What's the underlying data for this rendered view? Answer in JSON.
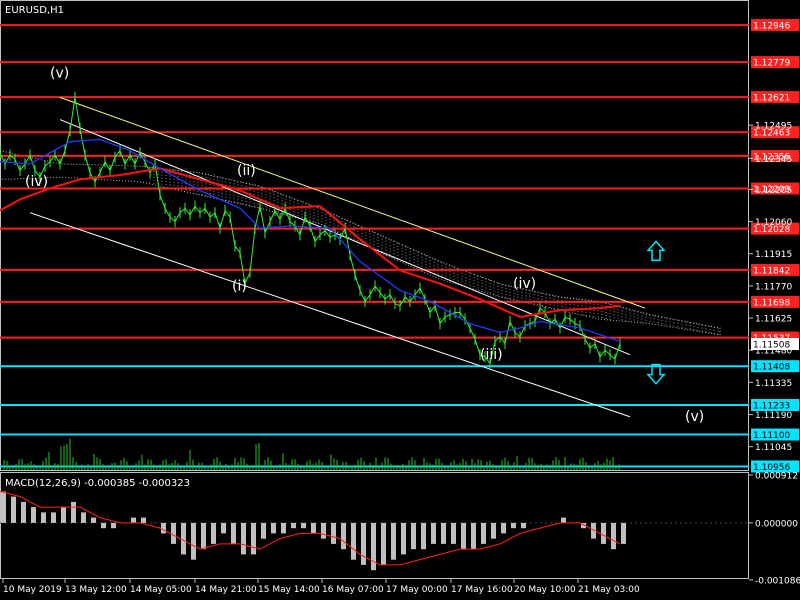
{
  "window": {
    "symbol_timeframe": "EURUSD,H1"
  },
  "chart_data": [
    {
      "type": "line",
      "title": "EURUSD,H1",
      "xlabel": "",
      "ylabel": "",
      "ylim": [
        1.1094,
        1.1305
      ],
      "grid": false,
      "x_ticks": [
        "10 May 2019",
        "13 May 12:00",
        "14 May 05:00",
        "14 May 21:00",
        "15 May 14:00",
        "16 May 07:00",
        "17 May 00:00",
        "17 May 16:00",
        "20 May 10:00",
        "21 May 03:00"
      ],
      "y_ticks": [
        1.12495,
        1.12345,
        1.12205,
        1.1206,
        1.11915,
        1.1177,
        1.11625,
        1.1148,
        1.11335,
        1.1119,
        1.11045
      ],
      "current_price": 1.11508,
      "level_lines": [
        {
          "price": 1.12946,
          "label": "1.12946",
          "color": "#ff2020"
        },
        {
          "price": 1.12779,
          "label": "1.12779",
          "color": "#ff2020"
        },
        {
          "price": 1.12621,
          "label": "1.12621",
          "color": "#ff2020"
        },
        {
          "price": 1.12463,
          "label": "1.12463",
          "color": "#ff2020"
        },
        {
          "price": 1.12356,
          "label": "1.12356",
          "color": "#ff2020"
        },
        {
          "price": 1.12209,
          "label": "1.12209",
          "color": "#ff2020"
        },
        {
          "price": 1.12028,
          "label": "1.12028",
          "color": "#ff2020"
        },
        {
          "price": 1.11842,
          "label": "1.11842",
          "color": "#ff2020"
        },
        {
          "price": 1.11698,
          "label": "1.11698",
          "color": "#ff2020"
        },
        {
          "price": 1.11537,
          "label": "1.11537",
          "color": "#ff2020"
        },
        {
          "price": 1.11408,
          "label": "1.11408",
          "color": "#00e5ff"
        },
        {
          "price": 1.11233,
          "label": "1.11233",
          "color": "#00e5ff"
        },
        {
          "price": 1.111,
          "label": "1.11100",
          "color": "#00e5ff"
        },
        {
          "price": 1.10956,
          "label": "1.10956",
          "color": "#00e5ff"
        }
      ],
      "series": [
        {
          "name": "",
          "color": "#33ee33",
          "x": [
            0,
            5,
            10,
            15,
            20,
            25,
            30,
            35,
            40,
            45,
            50,
            55,
            60,
            65,
            70,
            75,
            80,
            85,
            90,
            95,
            100,
            105,
            110,
            115,
            120,
            125,
            130,
            135,
            140,
            145,
            150,
            155,
            160,
            165,
            170,
            175,
            180,
            185,
            190,
            195,
            200,
            205,
            210,
            215,
            220,
            225,
            230,
            235,
            240,
            245,
            250,
            255,
            260,
            265,
            270,
            275,
            280,
            285,
            290,
            295,
            300,
            305,
            310,
            315,
            320,
            325,
            330,
            335,
            340,
            345,
            350,
            355,
            360,
            365,
            370,
            375,
            380,
            385,
            390,
            395,
            400,
            405,
            410,
            415,
            420,
            425,
            430,
            435,
            440,
            445,
            450,
            455,
            460,
            465,
            470,
            475,
            480,
            485,
            490,
            495,
            500,
            505,
            510,
            515,
            520,
            525,
            530,
            535,
            540,
            545,
            550,
            555,
            560,
            565,
            570,
            575,
            580,
            585,
            590,
            595,
            600,
            605,
            610,
            615,
            620
          ],
          "values": [
            1.1237,
            1.1232,
            1.1236,
            1.1234,
            1.1229,
            1.1232,
            1.1236,
            1.1229,
            1.1226,
            1.1231,
            1.1233,
            1.1236,
            1.1232,
            1.1238,
            1.1247,
            1.1262,
            1.1248,
            1.1236,
            1.1228,
            1.1224,
            1.1228,
            1.1233,
            1.1229,
            1.1235,
            1.1238,
            1.1232,
            1.1236,
            1.1232,
            1.1237,
            1.1233,
            1.1228,
            1.1232,
            1.1218,
            1.1212,
            1.1208,
            1.1206,
            1.121,
            1.1212,
            1.1209,
            1.1213,
            1.121,
            1.1212,
            1.1208,
            1.121,
            1.1203,
            1.1211,
            1.1208,
            1.1195,
            1.1192,
            1.1178,
            1.1183,
            1.1203,
            1.1213,
            1.1201,
            1.1206,
            1.1211,
            1.1207,
            1.1212,
            1.1206,
            1.1204,
            1.12,
            1.1208,
            1.1204,
            1.1197,
            1.12,
            1.1202,
            1.1199,
            1.12,
            1.1198,
            1.1203,
            1.1191,
            1.1182,
            1.1175,
            1.117,
            1.1173,
            1.1177,
            1.1174,
            1.1171,
            1.1173,
            1.1169,
            1.1168,
            1.1172,
            1.117,
            1.1173,
            1.1176,
            1.1171,
            1.1165,
            1.1168,
            1.116,
            1.1163,
            1.1164,
            1.1165,
            1.1165,
            1.1162,
            1.1158,
            1.1153,
            1.1146,
            1.1145,
            1.1142,
            1.1152,
            1.1154,
            1.1151,
            1.1161,
            1.1156,
            1.1154,
            1.1159,
            1.116,
            1.1161,
            1.1167,
            1.1165,
            1.116,
            1.1162,
            1.1158,
            1.1163,
            1.1162,
            1.116,
            1.1159,
            1.1153,
            1.1149,
            1.1151,
            1.1145,
            1.1148,
            1.1146,
            1.1144,
            1.1151
          ]
        },
        {
          "name": "",
          "color": "#ff1010",
          "x": [
            0,
            20,
            50,
            80,
            120,
            160,
            200,
            240,
            280,
            320,
            360,
            400,
            440,
            480,
            520,
            560,
            600,
            620
          ],
          "values": [
            1.1211,
            1.1216,
            1.1221,
            1.1225,
            1.1227,
            1.123,
            1.1225,
            1.122,
            1.1212,
            1.1213,
            1.1198,
            1.1184,
            1.1178,
            1.1171,
            1.1163,
            1.1166,
            1.1167,
            1.1168
          ]
        },
        {
          "name": "",
          "color": "#1e3cff",
          "x": [
            0,
            30,
            70,
            100,
            130,
            160,
            200,
            240,
            260,
            290,
            330,
            360,
            400,
            430,
            470,
            500,
            520,
            540,
            580,
            620
          ],
          "values": [
            1.1233,
            1.1232,
            1.1242,
            1.1243,
            1.1238,
            1.123,
            1.122,
            1.1212,
            1.1203,
            1.1204,
            1.1203,
            1.1188,
            1.1175,
            1.117,
            1.116,
            1.1156,
            1.1158,
            1.1161,
            1.1158,
            1.1152
          ]
        }
      ],
      "channel_lines": [
        {
          "color": "#ffff80",
          "from": {
            "x": 60,
            "y": 1.1262
          },
          "to": {
            "x": 645,
            "y": 1.1167
          }
        },
        {
          "color": "#ffffff",
          "from": {
            "x": 60,
            "y": 1.1252
          },
          "to": {
            "x": 630,
            "y": 1.1146
          }
        },
        {
          "color": "#ffffff",
          "from": {
            "x": 30,
            "y": 1.121
          },
          "to": {
            "x": 630,
            "y": 1.1118
          }
        }
      ],
      "wave_labels": [
        {
          "text": "(v)",
          "x": 60,
          "y": 1.1271
        },
        {
          "text": "(iv)",
          "x": 35,
          "y": 1.1222
        },
        {
          "text": "(ii)",
          "x": 247,
          "y": 1.1227
        },
        {
          "text": "(i)",
          "x": 242,
          "y": 1.1175
        },
        {
          "text": "(iii)",
          "x": 490,
          "y": 1.1144
        },
        {
          "text": "(iv)",
          "x": 523,
          "y": 1.1176
        },
        {
          "text": "(v)",
          "x": 695,
          "y": 1.1116
        }
      ],
      "arrows": [
        {
          "direction": "up",
          "x": 656,
          "y": 1.1193,
          "color": "#00e5ff"
        },
        {
          "direction": "down",
          "x": 656,
          "y": 1.1137,
          "color": "#00e5ff"
        }
      ]
    },
    {
      "type": "bar",
      "title": "MACD(12,26,9) -0.000385 -0.000323",
      "ylabel": "",
      "ylim": [
        -0.00105,
        0.00095
      ],
      "y_ticks": [
        "0.000912",
        "0.000000",
        "-0.001086"
      ],
      "histogram_x": [
        0,
        10,
        20,
        30,
        40,
        50,
        60,
        70,
        80,
        90,
        100,
        110,
        120,
        130,
        140,
        150,
        160,
        170,
        180,
        190,
        200,
        210,
        220,
        230,
        240,
        250,
        260,
        270,
        280,
        290,
        300,
        310,
        320,
        330,
        340,
        350,
        360,
        370,
        380,
        390,
        400,
        410,
        420,
        430,
        440,
        450,
        460,
        470,
        480,
        490,
        500,
        510,
        520,
        530,
        540,
        550,
        560,
        570,
        580,
        590,
        600,
        610,
        620
      ],
      "histogram": [
        0.0006,
        0.0005,
        0.0004,
        0.0003,
        0.0002,
        0.0002,
        0.0003,
        0.0004,
        0.0002,
        0.0001,
        -0.0001,
        -0.0001,
        0.0,
        0.0001,
        0.0001,
        0.0,
        -0.0002,
        -0.0004,
        -0.0006,
        -0.0007,
        -0.0005,
        -0.0004,
        -0.0002,
        -0.0004,
        -0.0006,
        -0.0006,
        -0.0003,
        -0.0002,
        -0.0002,
        -0.0001,
        -0.0001,
        -0.0002,
        -0.0003,
        -0.0004,
        -0.0005,
        -0.0007,
        -0.0008,
        -0.0009,
        -0.0008,
        -0.0007,
        -0.0006,
        -0.0005,
        -0.0005,
        -0.0004,
        -0.0004,
        -0.0004,
        -0.0005,
        -0.0005,
        -0.0004,
        -0.0003,
        -0.0002,
        -0.0001,
        -0.0001,
        0.0,
        0.0,
        0.0,
        0.0001,
        0.0,
        -0.0001,
        -0.0003,
        -0.0004,
        -0.0005,
        -0.0004
      ],
      "signal_x": [
        0,
        20,
        40,
        60,
        80,
        100,
        120,
        140,
        160,
        180,
        200,
        220,
        240,
        260,
        280,
        300,
        320,
        340,
        360,
        380,
        400,
        420,
        440,
        460,
        480,
        500,
        520,
        540,
        560,
        580,
        600,
        620
      ],
      "signal": [
        0.0006,
        0.0005,
        0.0003,
        0.0003,
        0.0003,
        0.0001,
        0.0,
        0.0,
        -0.0001,
        -0.0003,
        -0.0005,
        -0.0004,
        -0.0004,
        -0.0005,
        -0.0003,
        -0.0002,
        -0.0002,
        -0.0003,
        -0.0006,
        -0.0008,
        -0.0008,
        -0.0007,
        -0.0006,
        -0.0005,
        -0.0005,
        -0.0004,
        -0.0002,
        -0.0001,
        0.0,
        0.0,
        -0.0002,
        -0.0004
      ],
      "signal_color": "#ff2020",
      "histogram_color": "#c0c0c0"
    }
  ]
}
